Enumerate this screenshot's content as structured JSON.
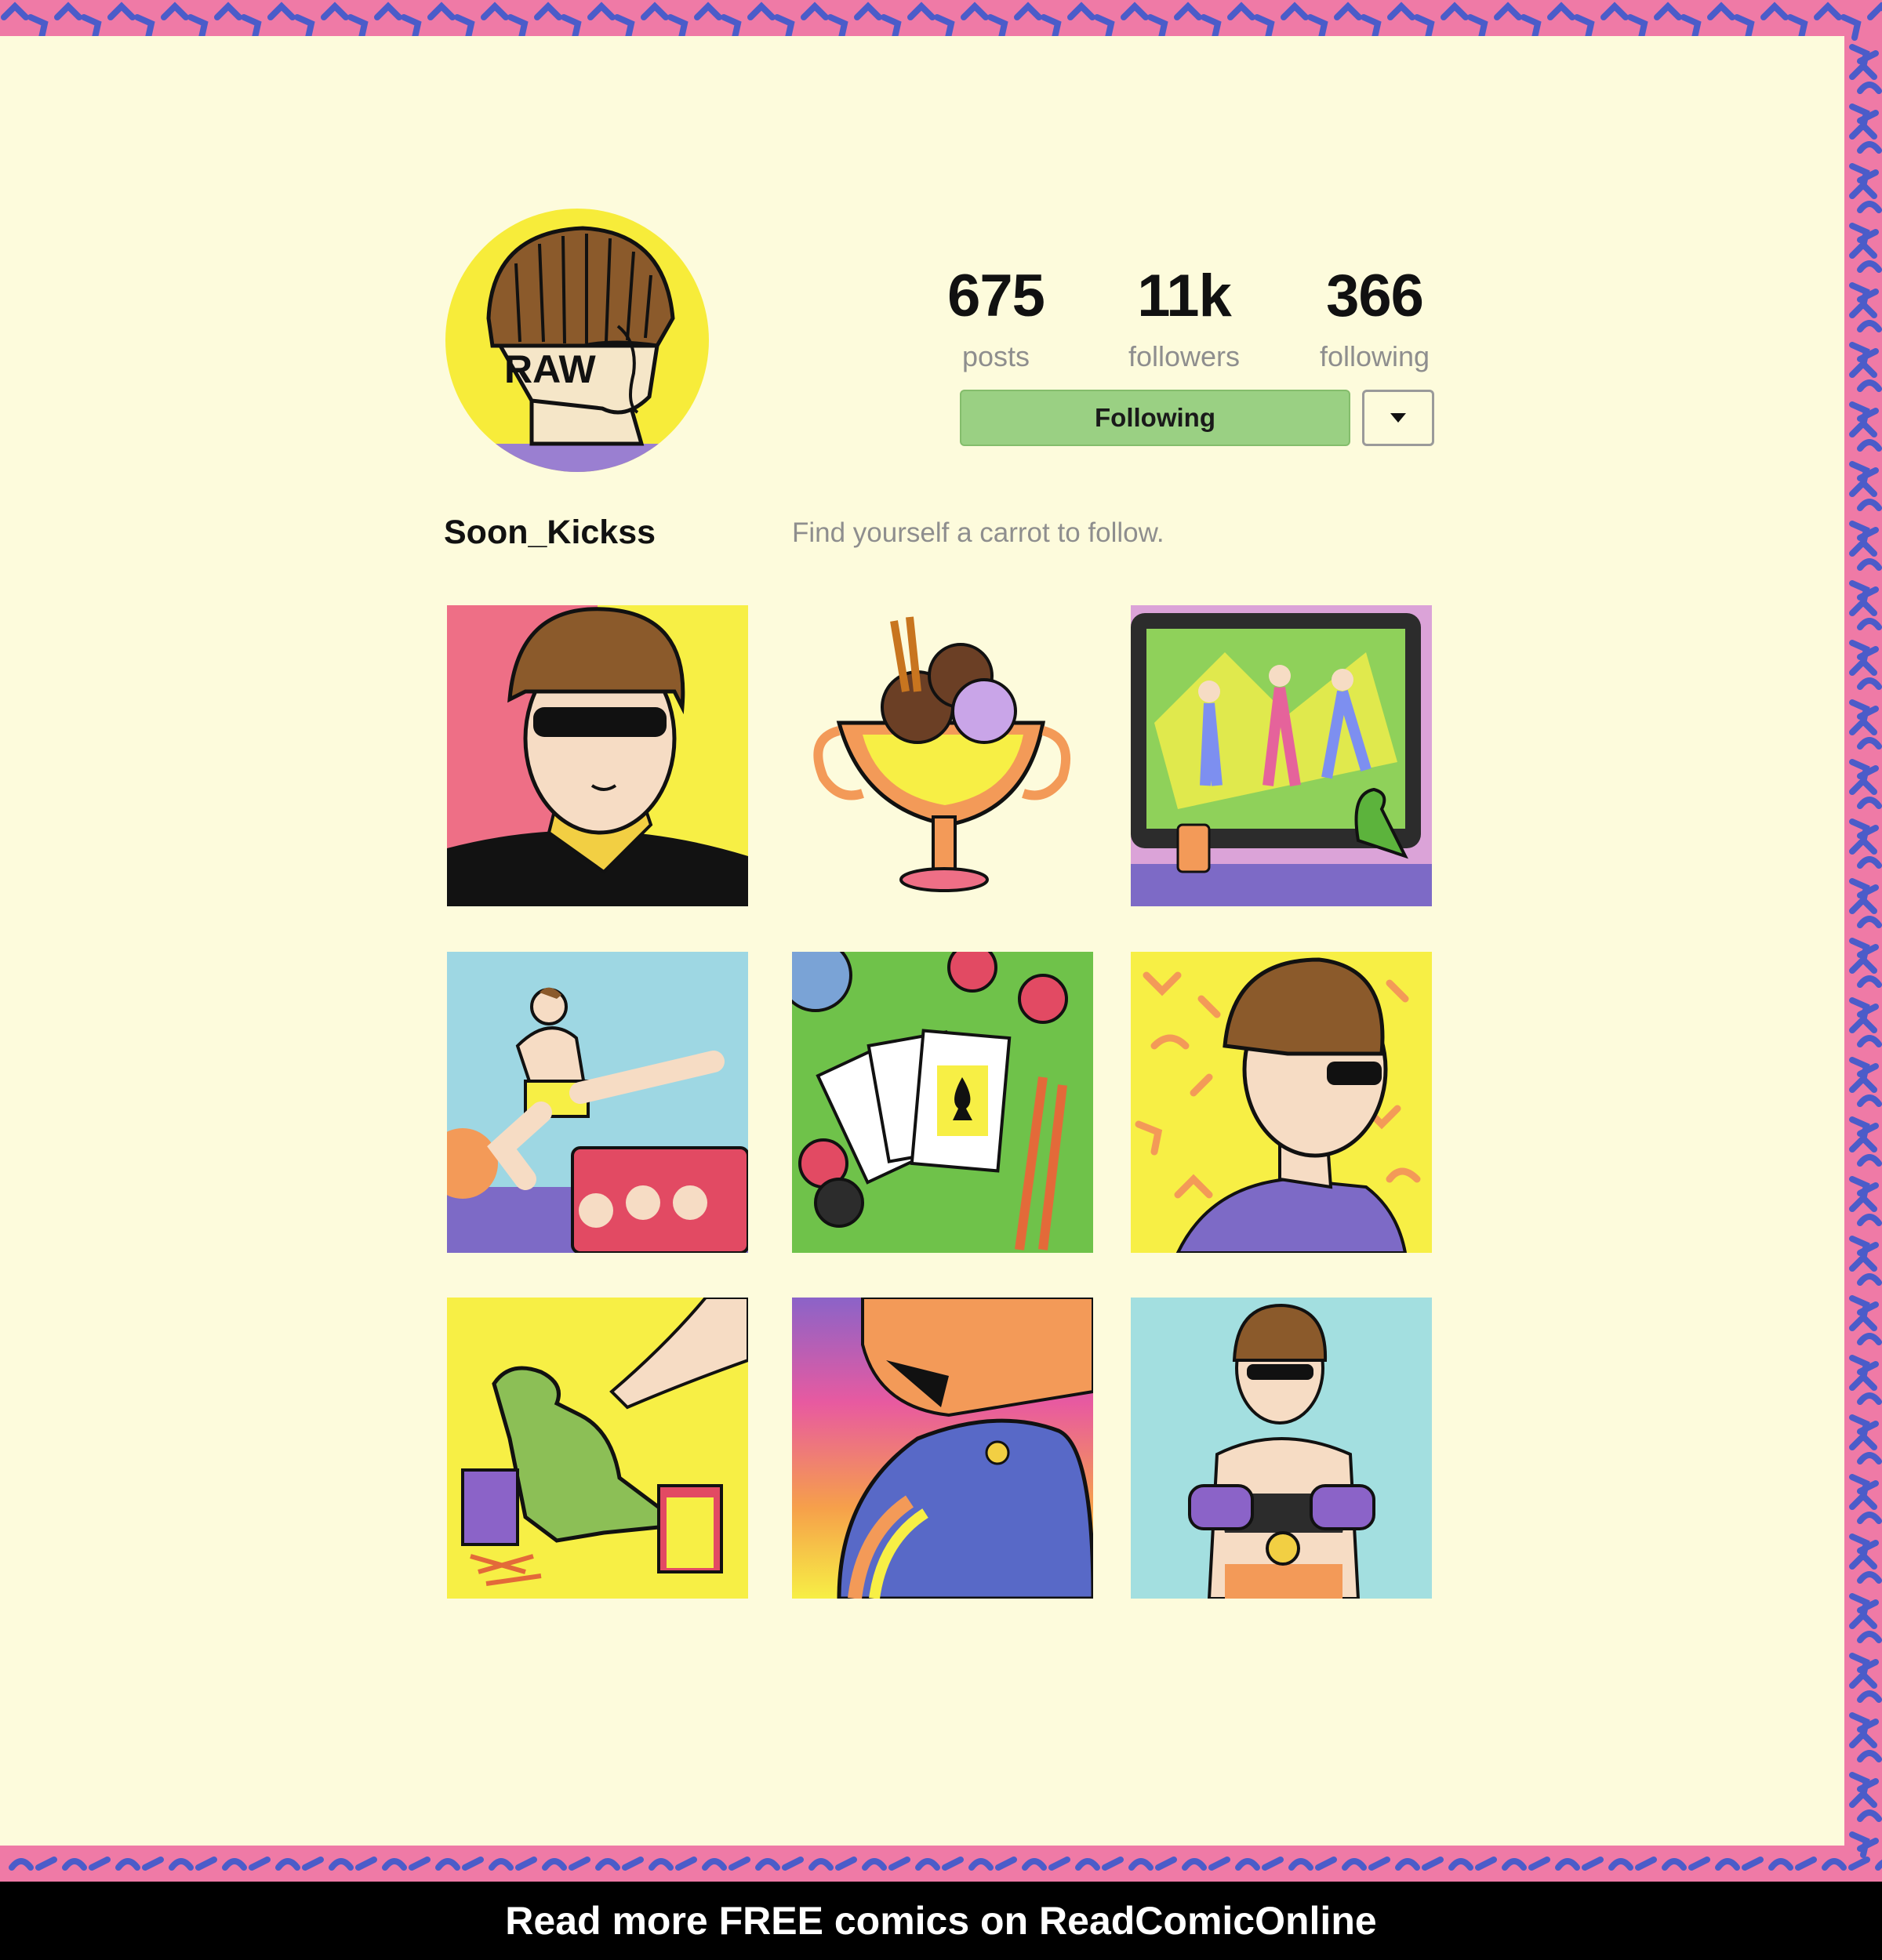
{
  "profile": {
    "username": "Soon_Kickss",
    "bio": "Find yourself a carrot to follow.",
    "avatar_text": "RAW"
  },
  "stats": {
    "posts": {
      "value": "675",
      "label": "posts"
    },
    "followers": {
      "value": "11k",
      "label": "followers"
    },
    "following": {
      "value": "366",
      "label": "following"
    }
  },
  "actions": {
    "follow_label": "Following",
    "dropdown_icon": "caret-down-icon"
  },
  "posts": [
    "portrait-sunglasses",
    "sundae-trophy",
    "tv-dancers-dinosaur",
    "flying-kick-fighter",
    "playing-cards-poker-chips",
    "profile-pattern-background",
    "hand-holding-dinosaur-toy",
    "sunset-jacket-closeup",
    "boxer-with-medal"
  ],
  "footer": {
    "text": "Read more FREE comics on ReadComicOnline"
  },
  "colors": {
    "background": "#fdfbdc",
    "border_pink": "#ef7aa6",
    "border_squiggle": "#4b5cc9",
    "follow_button": "#9ad083",
    "label_gray": "#8e8e8e"
  }
}
